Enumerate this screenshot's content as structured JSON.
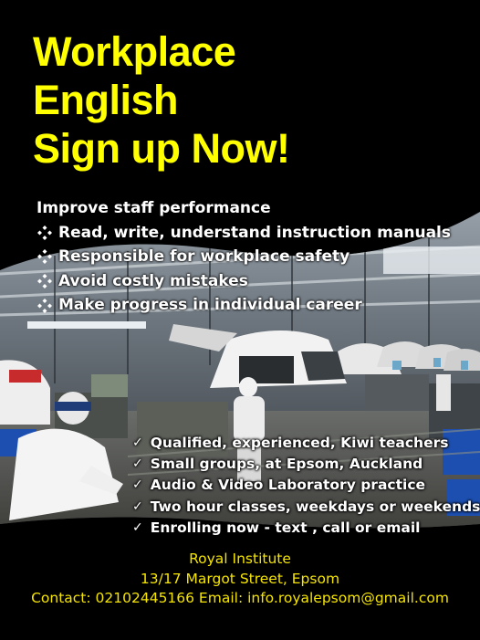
{
  "headline": [
    "Workplace",
    "English",
    "Sign up Now!"
  ],
  "benefits": {
    "intro": "Improve staff performance",
    "items": [
      "Read, write, understand instruction manuals",
      "Responsible for workplace safety",
      "Avoid costly mistakes",
      "Make progress in individual career"
    ]
  },
  "features": [
    "Qualified, experienced, Kiwi teachers",
    "Small groups, at Epsom, Auckland",
    "Audio & Video Laboratory practice",
    "Two hour classes, weekdays or weekends",
    "Enrolling now - text , call or email"
  ],
  "footer": {
    "name": "Royal Institute",
    "address": "13/17 Margot Street, Epsom",
    "contact": "Contact: 02102445166 Email: info.royalepsom@gmail.com"
  },
  "colors": {
    "background": "#000000",
    "headline": "#ffff00",
    "footer_text": "#f5e400",
    "body_text": "#ffffff"
  },
  "icons": {
    "benefit_bullet": "four-diamond-icon",
    "feature_bullet": "checkmark-icon"
  }
}
